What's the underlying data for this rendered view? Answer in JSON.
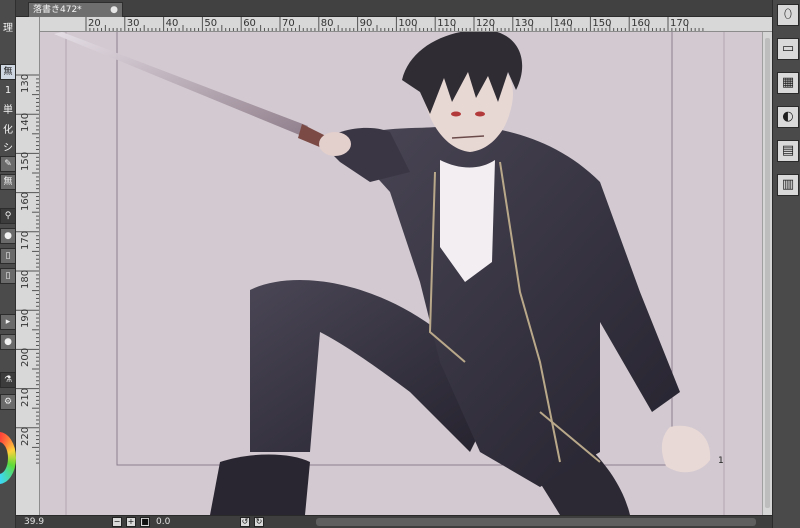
{
  "document_tab": {
    "title": "落書き472*",
    "close_glyph": "●"
  },
  "ruler_top": {
    "labels": [
      "20",
      "30",
      "40",
      "50",
      "60",
      "70",
      "80",
      "90",
      "100",
      "110",
      "120",
      "130",
      "140",
      "150",
      "160",
      "170"
    ]
  },
  "ruler_left": {
    "labels": [
      "130",
      "140",
      "150",
      "160",
      "170",
      "180",
      "190",
      "200",
      "210",
      "220"
    ]
  },
  "canvas": {
    "background": "#d3cad1",
    "page_number": "1"
  },
  "left_panel": {
    "labels": [
      "理",
      "無し",
      "1彩",
      "単",
      "化",
      "シュ",
      "無し"
    ],
    "icons": [
      "pen-icon",
      "paint-bucket-icon",
      "magnifier-icon",
      "slider-icon",
      "play-icon",
      "eyedropper-icon",
      "color-wheel"
    ]
  },
  "right_panel": {
    "icons": [
      "new-layer-icon",
      "folder-icon",
      "checkerboard-icon",
      "mask-icon",
      "layer-add-icon",
      "layer-settings-icon"
    ]
  },
  "statusbar": {
    "zoom": "39.9",
    "angle": "0.0"
  }
}
